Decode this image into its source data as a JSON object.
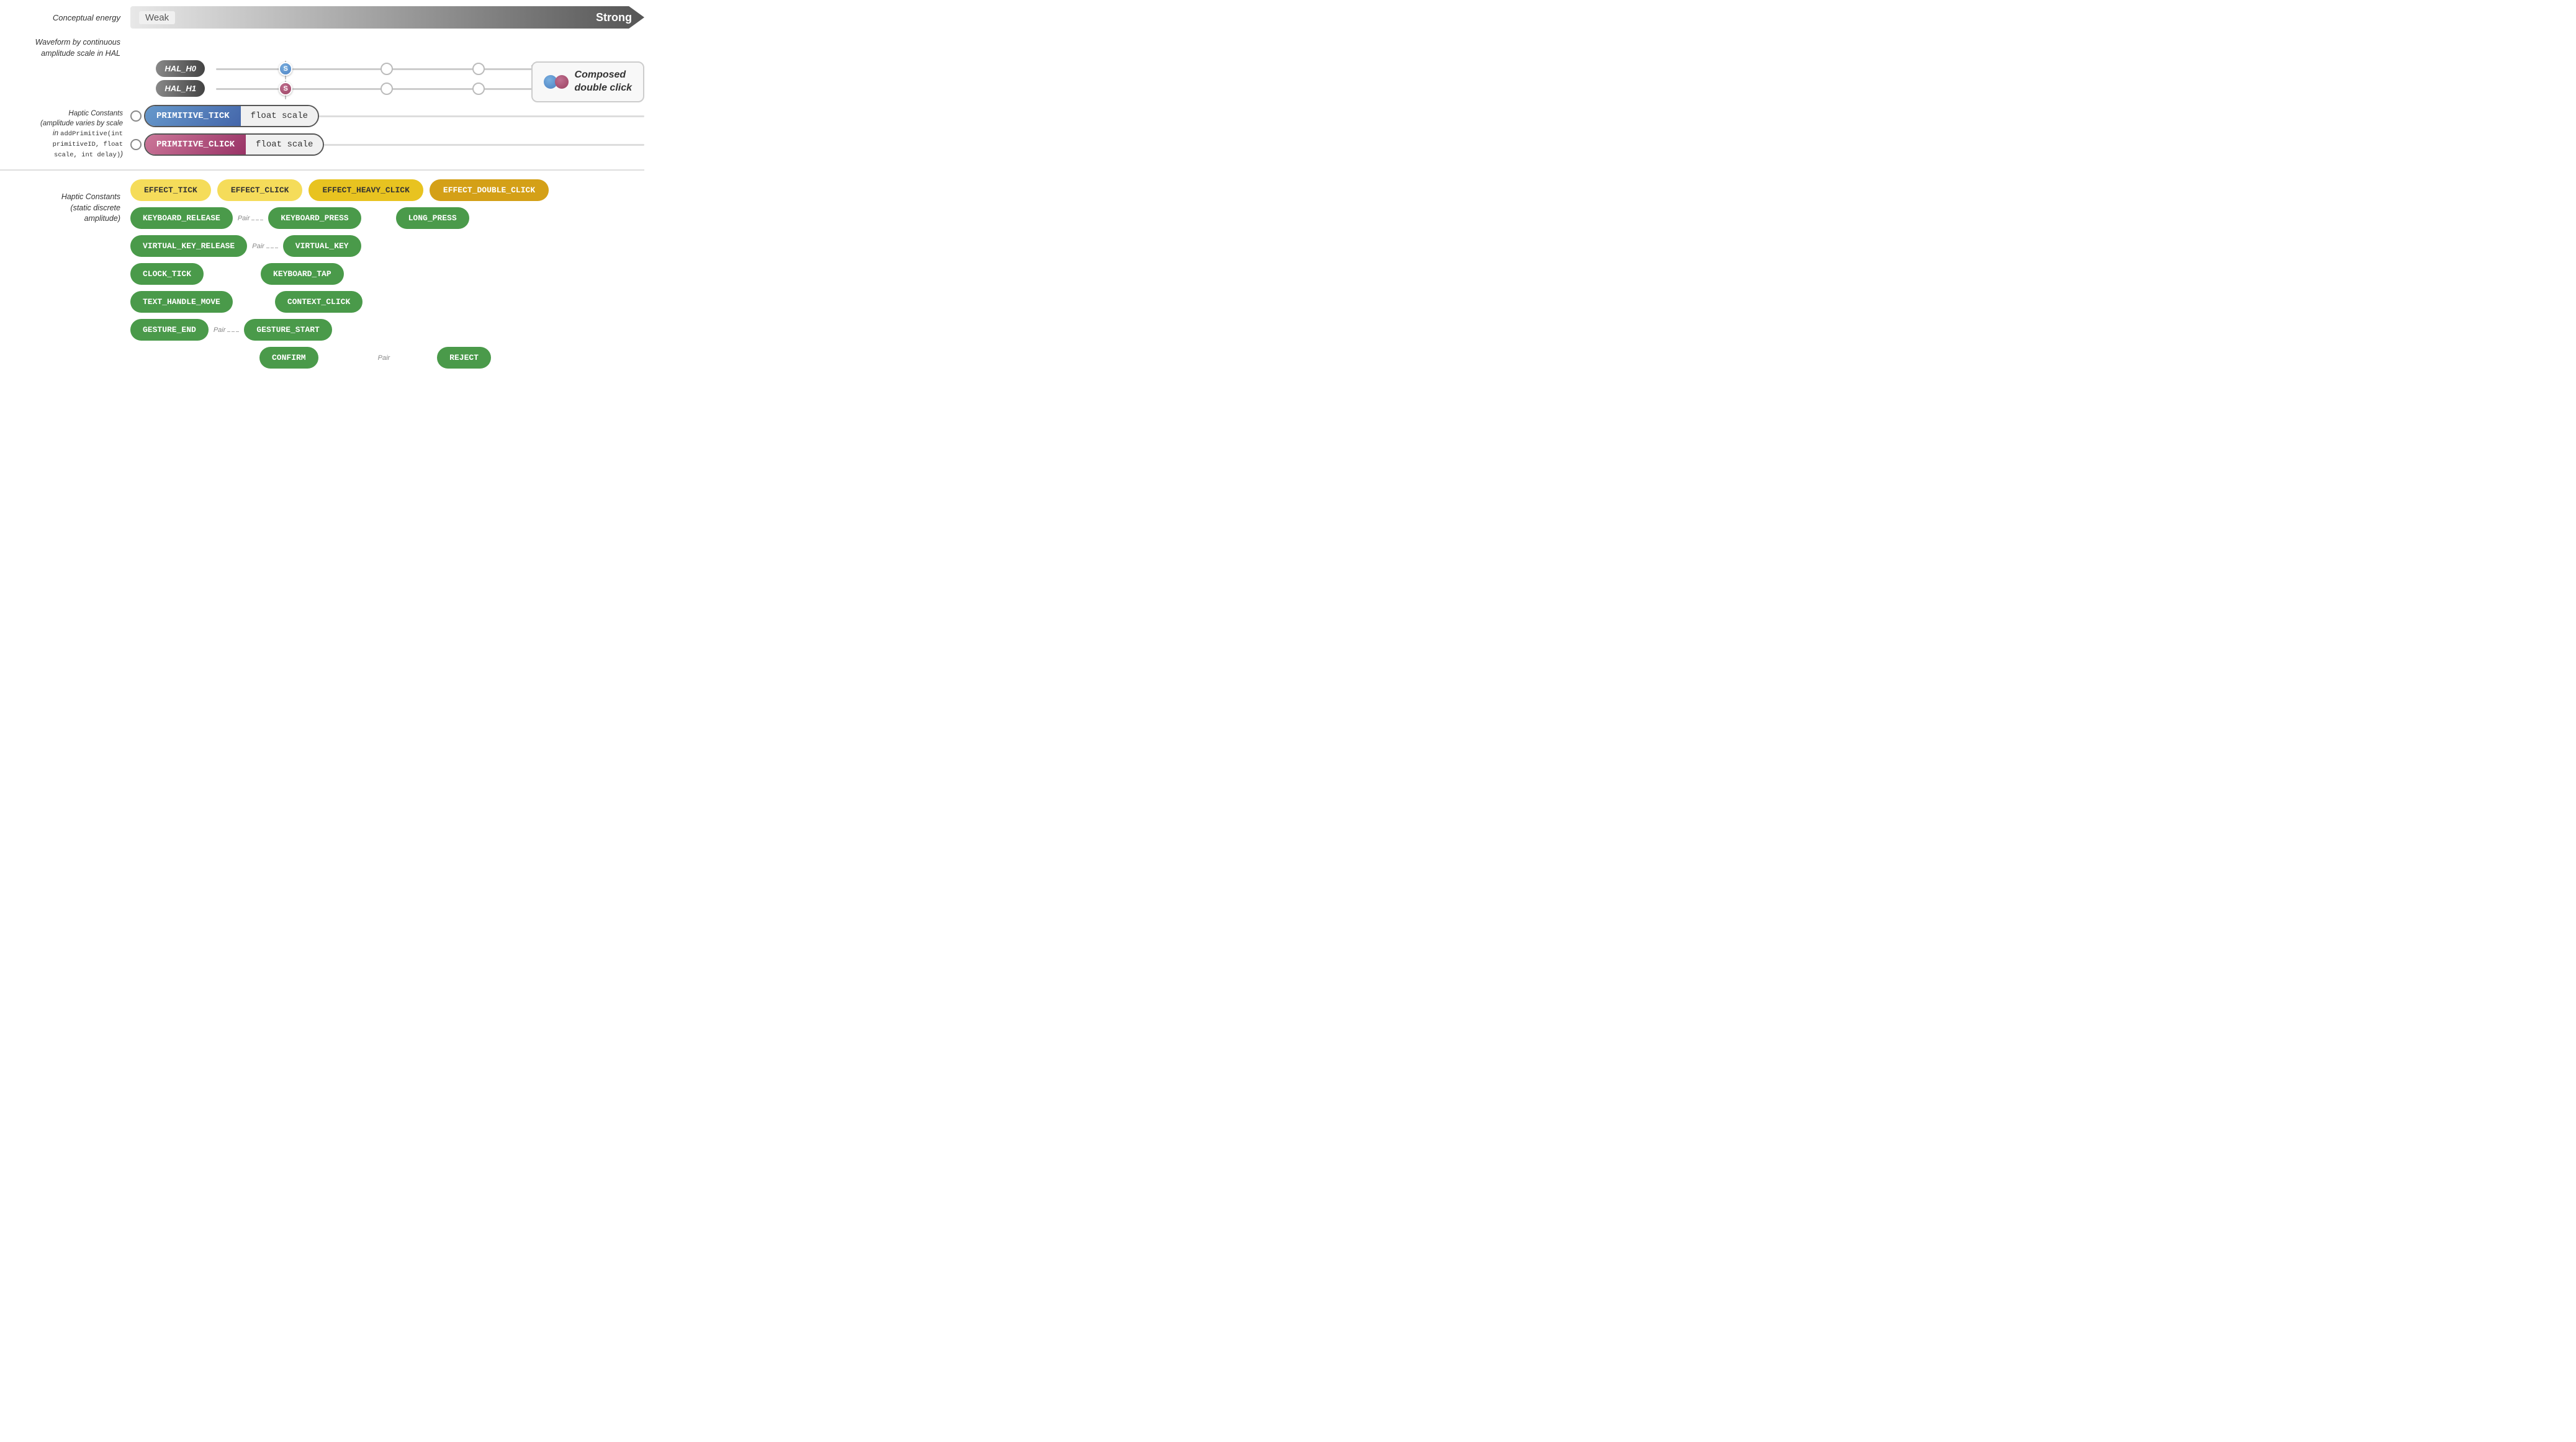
{
  "energy": {
    "label": "Conceptual energy",
    "weak": "Weak",
    "strong": "Strong"
  },
  "waveform": {
    "title": "Waveform by continuous amplitude scale in HAL"
  },
  "hal": {
    "h0": {
      "label": "HAL_H0",
      "dot": "S",
      "dot_type": "blue"
    },
    "h1": {
      "label": "HAL_H1",
      "dot": "S",
      "dot_type": "pink"
    }
  },
  "composed": {
    "label": "Composed\ndouble click"
  },
  "haptic_primitive": {
    "title": "Haptic Constants\n(amplitude varies by scale\nin addPrimitive(int\nprimitiveID, float\nscale, int delay))",
    "primitives": [
      {
        "name": "PRIMITIVE_TICK",
        "param": "float scale",
        "type": "tick"
      },
      {
        "name": "PRIMITIVE_CLICK",
        "param": "float scale",
        "type": "click"
      }
    ]
  },
  "haptic_discrete": {
    "title": "Haptic Constants\n(static discrete\namplitude)",
    "effects_row1": [
      {
        "label": "EFFECT_TICK",
        "style": "yellow"
      },
      {
        "label": "EFFECT_CLICK",
        "style": "yellow"
      },
      {
        "label": "EFFECT_HEAVY_CLICK",
        "style": "yellow-medium"
      },
      {
        "label": "EFFECT_DOUBLE_CLICK",
        "style": "yellow-dark"
      }
    ],
    "effects_row2_left": "KEYBOARD_RELEASE",
    "effects_row2_right": "KEYBOARD_PRESS",
    "effects_row2_far": "LONG_PRESS",
    "effects_row3_left": "VIRTUAL_KEY_RELEASE",
    "effects_row3_right": "VIRTUAL_KEY",
    "effects_row4_left": "CLOCK_TICK",
    "effects_row4_right": "KEYBOARD_TAP",
    "effects_row5_left": "TEXT_HANDLE_MOVE",
    "effects_row5_right": "CONTEXT_CLICK",
    "effects_row6_left": "GESTURE_END",
    "effects_row6_right": "GESTURE_START",
    "effects_row7_mid": "CONFIRM",
    "effects_row7_far": "REJECT",
    "pair_label": "Pair"
  }
}
